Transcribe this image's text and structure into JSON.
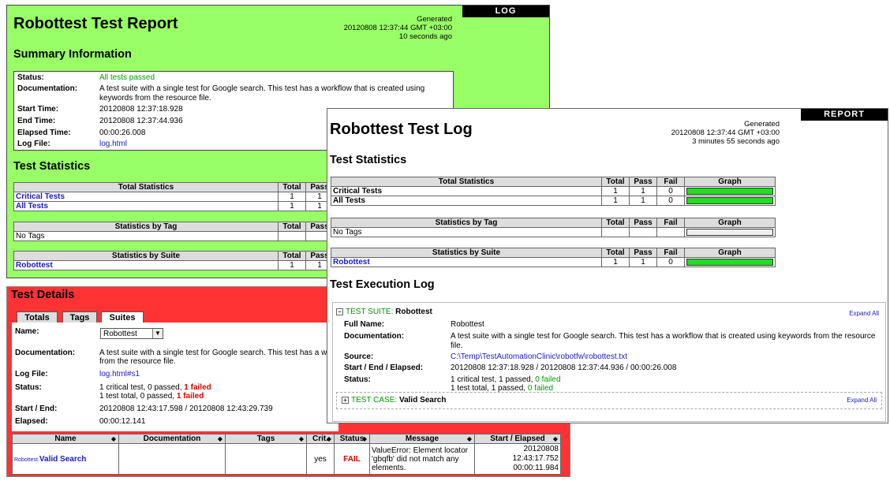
{
  "report": {
    "tag": "LOG",
    "title": "Robottest Test Report",
    "generated": [
      "Generated",
      "20120808 12:37:44 GMT +03:00",
      "10 seconds ago"
    ],
    "summary_heading": "Summary Information",
    "summary": {
      "status_key": "Status:",
      "status_val": "All tests passed",
      "doc_key": "Documentation:",
      "doc_val": "A test suite with a single test for Google search. This test has a workflow that is created using keywords from the resource file.",
      "start_key": "Start Time:",
      "start_val": "20120808 12:37:18.928",
      "end_key": "End Time:",
      "end_val": "20120808 12:37:44.936",
      "elapsed_key": "Elapsed Time:",
      "elapsed_val": "00:00:26.008",
      "logfile_key": "Log File:",
      "logfile_val": "log.html"
    },
    "stats_heading": "Test Statistics",
    "total_header": [
      "Total Statistics",
      "Total",
      "Pass"
    ],
    "total_rows": [
      [
        "Critical Tests",
        "1",
        "1"
      ],
      [
        "All Tests",
        "1",
        "1"
      ]
    ],
    "tag_header": [
      "Statistics by Tag",
      "Total",
      "Pass"
    ],
    "tag_rows": [
      [
        "No Tags",
        "",
        ""
      ]
    ],
    "suite_header": [
      "Statistics by Suite",
      "Total",
      "Pass"
    ],
    "suite_rows": [
      [
        "Robottest",
        "1",
        "1"
      ]
    ]
  },
  "details": {
    "title": "Test Details",
    "tabs": [
      "Totals",
      "Tags",
      "Suites"
    ],
    "name_key": "Name:",
    "name_select": "Robottest",
    "doc_key": "Documentation:",
    "doc_val": "A test suite with a single test for Google search. This test has a w",
    "doc_val2": "from the resource file.",
    "logfile_key": "Log File:",
    "logfile_val": "log.html#s1",
    "status_key": "Status:",
    "status_line1_a": "1 critical test, 0 passed, ",
    "status_line1_b": "1 failed",
    "status_line2_a": "1 test total, 0 passed, ",
    "status_line2_b": "1 failed",
    "startend_key": "Start / End:",
    "startend_val": "20120808 12:43:17.598 / 20120808 12:43:29.739",
    "elapsed_key": "Elapsed:",
    "elapsed_val": "00:00:12.141",
    "table_headers": [
      "Name",
      "Documentation",
      "Tags",
      "Crit.",
      "Status",
      "Message",
      "Start / Elapsed"
    ],
    "row": {
      "name_prefix": "Robottest.",
      "name": "Valid Search",
      "documentation": "",
      "tags": "",
      "crit": "yes",
      "status": "FAIL",
      "message": "ValueError: Element locator 'gbqfb' did not match any elements.",
      "start": "20120808 12:43:17.752",
      "elapsed": "00:00:11.984"
    }
  },
  "log": {
    "tag": "REPORT",
    "title": "Robottest Test Log",
    "generated": [
      "Generated",
      "20120808 12:37:44 GMT +03:00",
      "3 minutes 55 seconds ago"
    ],
    "stats_heading": "Test Statistics",
    "total_header": [
      "Total Statistics",
      "Total",
      "Pass",
      "Fail",
      "Graph"
    ],
    "total_rows": [
      [
        "Critical Tests",
        "1",
        "1",
        "0"
      ],
      [
        "All Tests",
        "1",
        "1",
        "0"
      ]
    ],
    "tag_header": [
      "Statistics by Tag",
      "Total",
      "Pass",
      "Fail",
      "Graph"
    ],
    "tag_rows": [
      [
        "No Tags",
        "",
        "",
        ""
      ]
    ],
    "suite_header": [
      "Statistics by Suite",
      "Total",
      "Pass",
      "Fail",
      "Graph"
    ],
    "suite_rows": [
      [
        "Robottest",
        "1",
        "1",
        "0"
      ]
    ],
    "exec_heading": "Test Execution Log",
    "suite_label": "TEST SUITE:",
    "suite_name": "Robottest",
    "expand_all": "Expand All",
    "fullname_key": "Full Name:",
    "fullname_val": "Robottest",
    "doc_key": "Documentation:",
    "doc_val": "A test suite with a single test for Google search. This test has a workflow that is created using keywords from the resource file.",
    "source_key": "Source:",
    "source_val": "C:\\Temp\\TestAutomationClinic\\robotfw\\robottest.txt",
    "startend_key": "Start / End / Elapsed:",
    "startend_val": "20120808 12:37:18.928 / 20120808 12:37:44.936 / 00:00:26.008",
    "status_key": "Status:",
    "status_line1_a": "1 critical test, 1 passed, ",
    "status_line1_b": "0 failed",
    "status_line2_a": "1 test total, 1 passed, ",
    "status_line2_b": "0 failed",
    "case_label": "TEST CASE:",
    "case_name": "Valid Search",
    "case_expand_all": "Expand All"
  }
}
